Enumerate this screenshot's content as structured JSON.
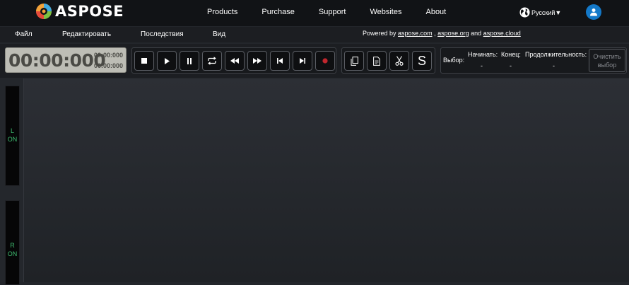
{
  "header": {
    "brand": "ASPOSE",
    "nav": [
      "Products",
      "Purchase",
      "Support",
      "Websites",
      "About"
    ],
    "language": "Русский▼"
  },
  "menu": {
    "items": [
      "Файл",
      "Редактировать",
      "Последствия",
      "Вид"
    ],
    "powered_prefix": "Powered by",
    "link1": "aspose.com",
    "sep1": ",",
    "link2": "aspose.org",
    "sep2": "and",
    "link3": "aspose.cloud"
  },
  "timer": {
    "main": "00:00:000",
    "sub1": "00:00:000",
    "sub2": "00:00:000"
  },
  "selection": {
    "label": "Выбор:",
    "start_label": "Начинать:",
    "start_value": "-",
    "end_label": "Конец:",
    "end_value": "-",
    "duration_label": "Продолжительность:",
    "duration_value": "-",
    "clear_line1": "Очистить",
    "clear_line2": "выбор"
  },
  "channels": {
    "left_name": "L",
    "left_state": "ON",
    "right_name": "R",
    "right_state": "ON"
  },
  "colors": {
    "accent_blue": "#1479c9",
    "channel_green": "#3fbf72",
    "record_red": "#c0262d"
  }
}
